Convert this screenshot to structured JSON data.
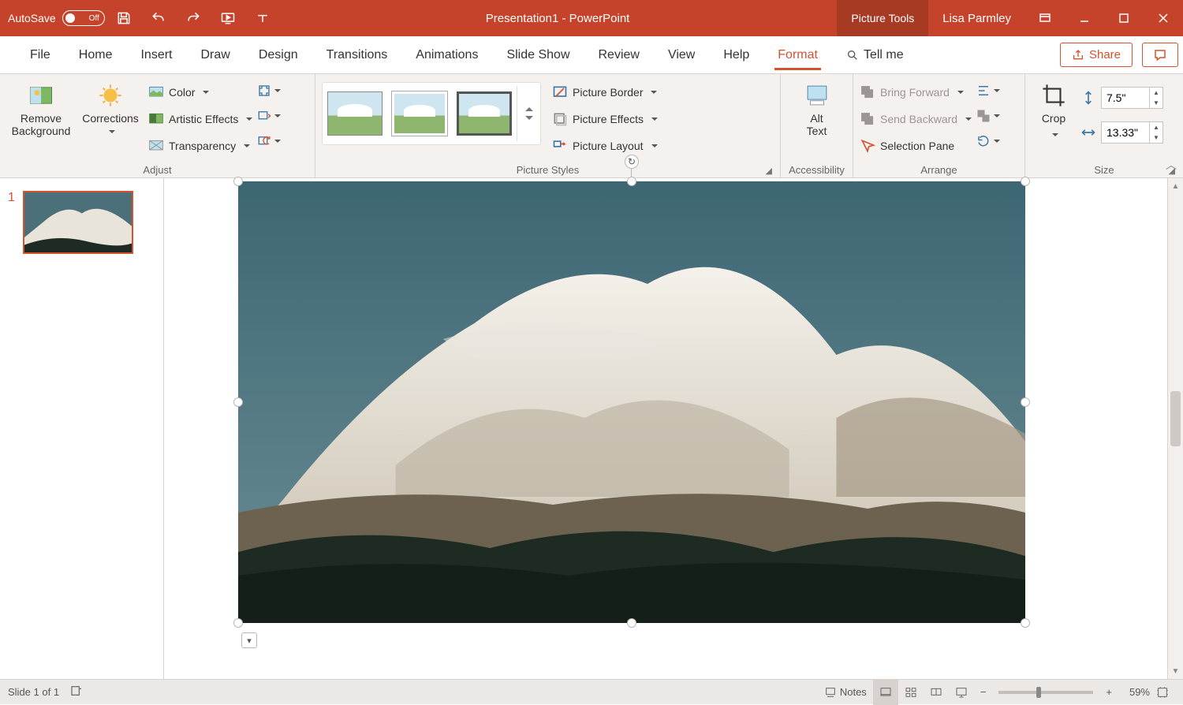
{
  "titlebar": {
    "autosave_label": "AutoSave",
    "autosave_state": "Off",
    "doc_title": "Presentation1  -  PowerPoint",
    "tool_context": "Picture Tools",
    "user": "Lisa Parmley"
  },
  "tabs": {
    "file": "File",
    "home": "Home",
    "insert": "Insert",
    "draw": "Draw",
    "design": "Design",
    "transitions": "Transitions",
    "animations": "Animations",
    "slideshow": "Slide Show",
    "review": "Review",
    "view": "View",
    "help": "Help",
    "format": "Format",
    "tellme": "Tell me",
    "share": "Share"
  },
  "ribbon": {
    "adjust": {
      "remove_bg": "Remove\nBackground",
      "corrections": "Corrections",
      "color": "Color",
      "artistic": "Artistic Effects",
      "transparency": "Transparency",
      "group": "Adjust"
    },
    "styles": {
      "border": "Picture Border",
      "effects": "Picture Effects",
      "layout": "Picture Layout",
      "group": "Picture Styles"
    },
    "a11y": {
      "alt_text": "Alt\nText",
      "group": "Accessibility"
    },
    "arrange": {
      "forward": "Bring Forward",
      "backward": "Send Backward",
      "selpane": "Selection Pane",
      "group": "Arrange"
    },
    "size": {
      "crop": "Crop",
      "height": "7.5\"",
      "width": "13.33\"",
      "group": "Size"
    }
  },
  "thumbs": {
    "slide1_num": "1"
  },
  "status": {
    "slide_of": "Slide 1 of 1",
    "notes": "Notes",
    "zoom": "59%"
  }
}
